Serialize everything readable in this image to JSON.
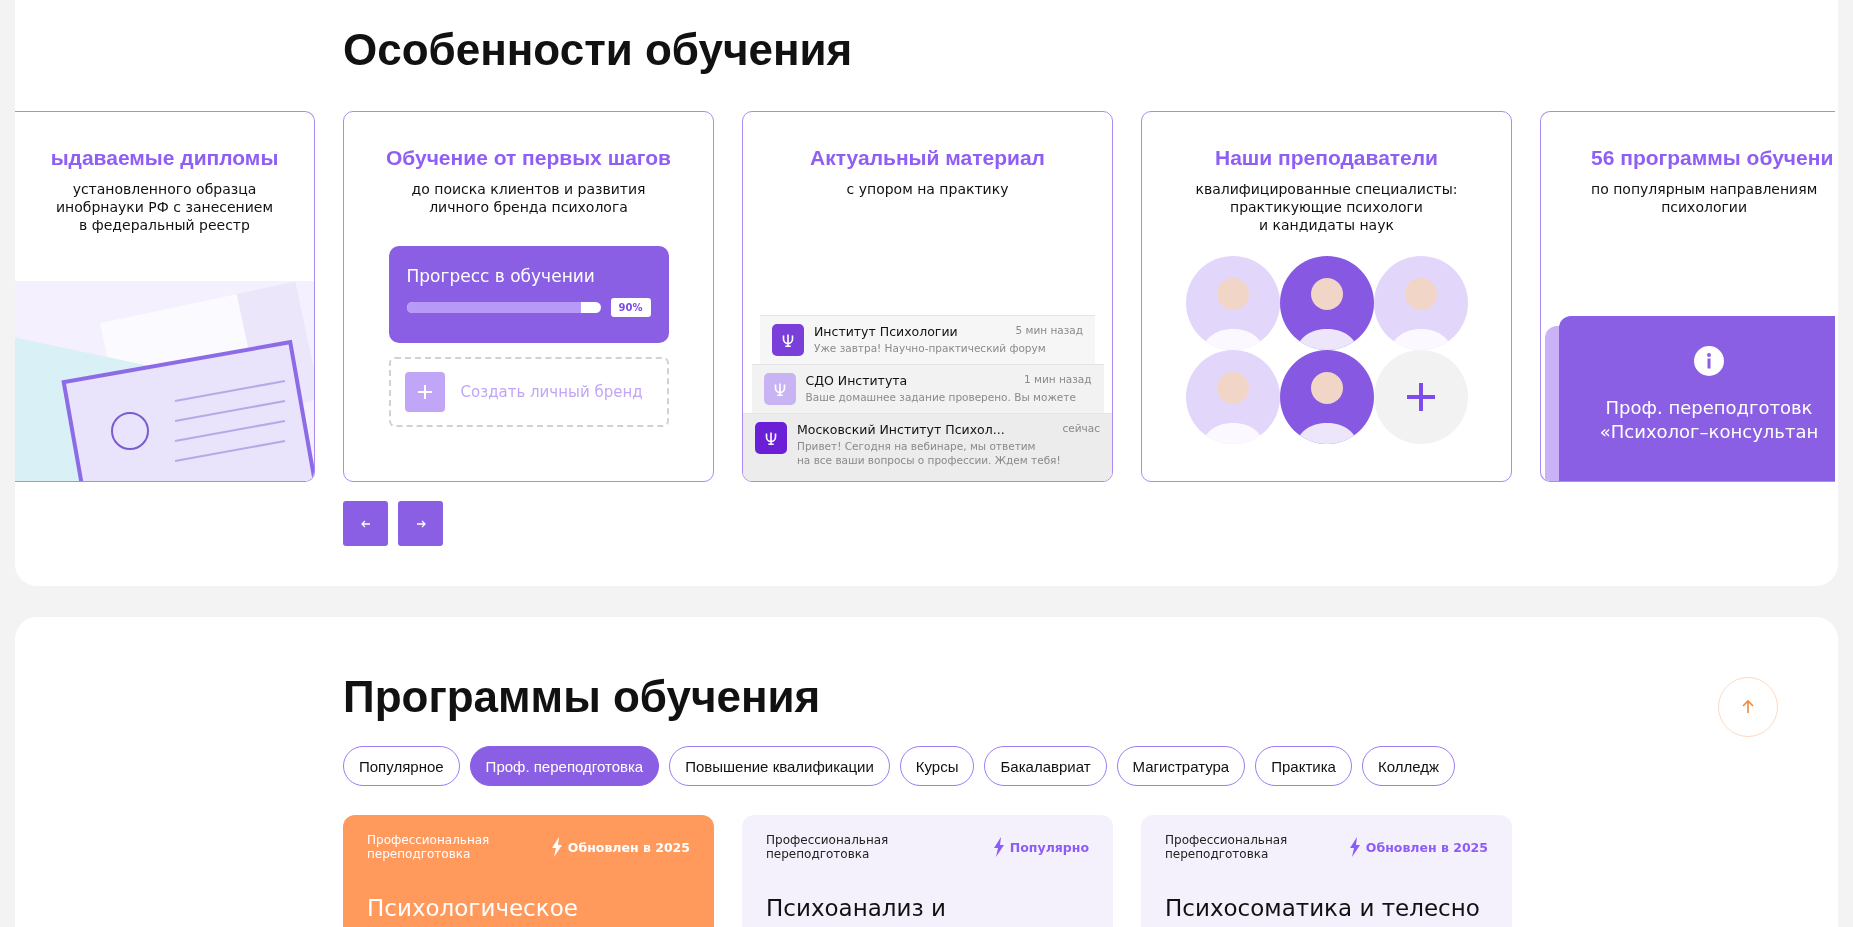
{
  "features": {
    "title": "Особенности обучения",
    "cards": [
      {
        "kind": "diplomas",
        "title": "ыдаваемые дипломы",
        "subtitle": [
          "установленного образца",
          "инобрнауки РФ с занесением",
          "в федеральный реестр"
        ]
      },
      {
        "kind": "progress",
        "title": "Обучение от первых шагов",
        "subtitle": [
          "до поиска клиентов и развития",
          "личного бренда психолога"
        ],
        "label": "Прогресс в обучении",
        "level": 0.9,
        "reading": "90%",
        "action": "Создать личный бренд"
      },
      {
        "kind": "notifications",
        "title": "Актуальный материал",
        "subtitle": [
          "с упором на практику"
        ],
        "items": [
          {
            "sender": "Институт Психологии",
            "time": "5 мин назад",
            "message": [
              "Уже завтра! Научно-практический форум"
            ]
          },
          {
            "sender": "СДО Института",
            "time": "1 мин назад",
            "message": [
              "Ваше домашнее задание проверено. Вы можете"
            ]
          },
          {
            "sender": "Московский Институт Психол...",
            "time": "сейчас",
            "message": [
              "Привет! Сегодня на вебинаре, мы ответим",
              "на все ваши вопросы о профессии. Ждем тебя!"
            ]
          }
        ]
      },
      {
        "kind": "teachers",
        "title": "Наши преподаватели",
        "subtitle": [
          "квалифицированные специалисты:",
          "практикующие психологи",
          "и кандидаты наук"
        ]
      },
      {
        "kind": "programs",
        "title": "56 программы обучени",
        "subtitle": [
          "по популярным направлениям",
          "психологии"
        ],
        "banner": [
          "Проф. переподготовк",
          "«Психолог–консультан"
        ]
      }
    ]
  },
  "programs": {
    "title": "Программы обучения",
    "filters": [
      {
        "label": "Популярное",
        "selected": false
      },
      {
        "label": "Проф. переподготовка",
        "selected": true
      },
      {
        "label": "Повышение квалификации",
        "selected": false
      },
      {
        "label": "Курсы",
        "selected": false
      },
      {
        "label": "Бакалавриат",
        "selected": false
      },
      {
        "label": "Магистратура",
        "selected": false
      },
      {
        "label": "Практика",
        "selected": false
      },
      {
        "label": "Колледж",
        "selected": false
      }
    ],
    "courses": [
      {
        "category": "Профессиональная переподготовка",
        "badge": "Обновлен в 2025",
        "title": "Психологическое",
        "color": "#ff9a5c"
      },
      {
        "category": "Профессиональная переподготовка",
        "badge": "Популярно",
        "title": "Психоанализ и",
        "color": "#f4f1fd"
      },
      {
        "category": "Профессиональная переподготовка",
        "badge": "Обновлен в 2025",
        "title": "Психосоматика и телесно",
        "color": "#f4f1fd"
      }
    ]
  }
}
